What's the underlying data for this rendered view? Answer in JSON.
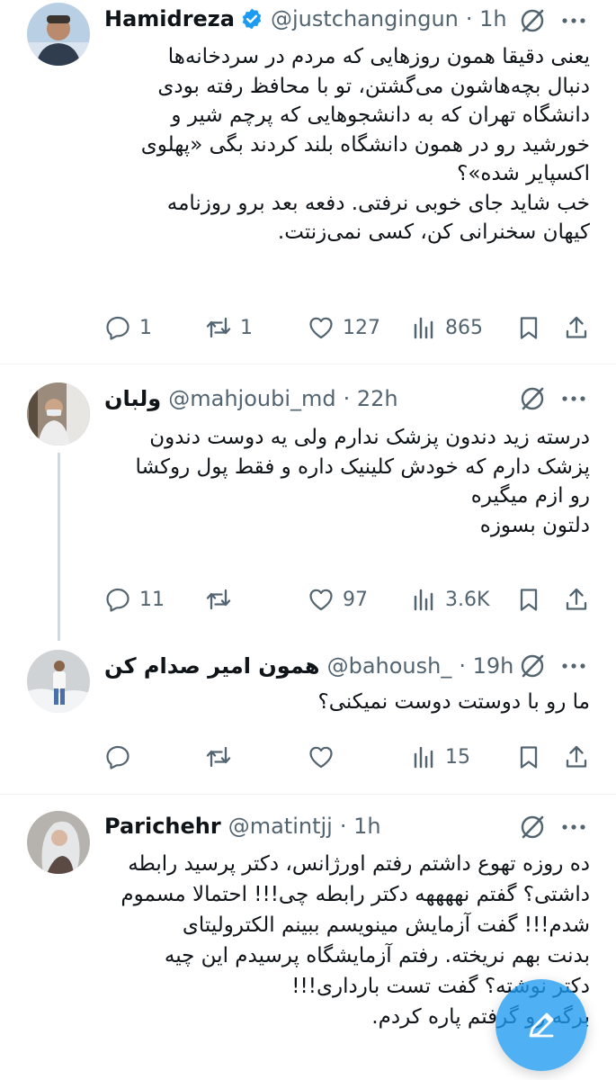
{
  "tweets": [
    {
      "name": "Hamidreza",
      "handle": "@justchangingun",
      "time": "· 1h",
      "verified": true,
      "lines": [
        "یعنی دقیقا همون روزهایی که مردم در سردخانه‌ها",
        "دنبال بچه‌هاشون می‌گشتن، تو با محافظ رفته بودی",
        "دانشگاه تهران که به دانشجوهایی که پرچم شیر و",
        "خورشید رو در همون دانشگاه بلند کردند بگی «پهلوی",
        "اکسپایر شده»؟",
        "خب شاید جای خوبی نرفتی. دفعه بعد برو روزنامه",
        "کیهان سخنرانی کن، کسی نمی‌زنتت."
      ],
      "replies": "1",
      "retweets": "1",
      "likes": "127",
      "views": "865"
    },
    {
      "name": "ولبان",
      "handle": "@mahjoubi_md",
      "time": "· 22h",
      "verified": false,
      "lines": [
        "درسته زید دندون پزشک ندارم ولی یه دوست دندون",
        "پزشک دارم که خودش کلینیک داره و فقط پول روکشا",
        "رو ازم میگیره",
        "دلتون بسوزه"
      ],
      "replies": "11",
      "retweets": "",
      "likes": "97",
      "views": "3.6K"
    },
    {
      "name": "همون امیر صدام کن",
      "handle": "@bahoush_",
      "time": "· 19h",
      "verified": false,
      "lines": [
        "ما رو با دوستت دوست نمیکنی؟"
      ],
      "replies": "",
      "retweets": "",
      "likes": "",
      "views": "15"
    },
    {
      "name": "Parichehr",
      "handle": "@matintjj",
      "time": "· 1h",
      "verified": false,
      "lines": [
        "ده روزه تهوع داشتم رفتم اورژانس، دکتر پرسید رابطه",
        "داشتی؟ گفتم نههههه دکتر رابطه چی!!! احتمالا مسموم",
        "شدم!!! گفت آزمایش مینویسم ببینم الکترولیتای",
        "بدنت بهم نریخته. رفتم آزمایشگاه پرسیدم این چیه",
        "دکتر نوشته؟ گفت تست بارداری!!!",
        "برگه رو گرفتم پاره کردم."
      ]
    }
  ],
  "icons": {
    "reply": "reply-icon",
    "retweet": "retweet-icon",
    "like": "like-icon",
    "views": "views-icon",
    "bookmark": "bookmark-icon",
    "share": "share-icon",
    "grok": "grok-icon",
    "more": "more-icon",
    "compose": "compose-icon"
  },
  "colors": {
    "text": "#0f1419",
    "secondary": "#536471",
    "accent": "#1d9bf0",
    "divider": "#eff3f4"
  }
}
